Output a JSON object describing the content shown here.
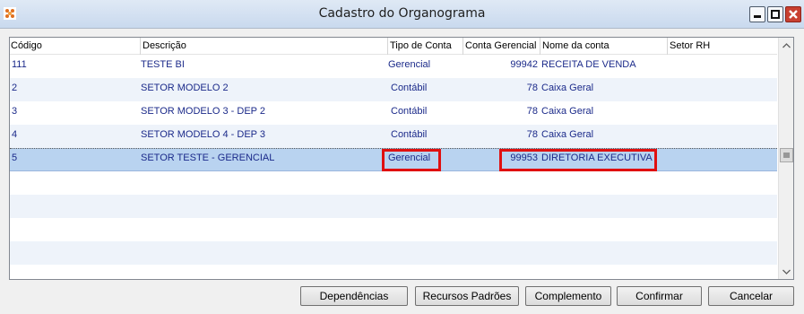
{
  "window": {
    "title": "Cadastro do Organograma",
    "controls": [
      "minimize",
      "maximize",
      "close"
    ]
  },
  "grid": {
    "columns": [
      "Código",
      "Descrição",
      "Tipo de Conta",
      "Conta Gerencial",
      "Nome da conta",
      "Setor RH"
    ],
    "rows": [
      {
        "codigo": "111",
        "descricao": "TESTE BI",
        "tipo": "Gerencial",
        "conta": "99942",
        "nome": "RECEITA DE VENDA",
        "setor": ""
      },
      {
        "codigo": "2",
        "descricao": "SETOR MODELO 2",
        "tipo": "Contábil",
        "conta": "78",
        "nome": "Caixa Geral",
        "setor": ""
      },
      {
        "codigo": "3",
        "descricao": "SETOR MODELO 3 - DEP 2",
        "tipo": "Contábil",
        "conta": "78",
        "nome": "Caixa Geral",
        "setor": ""
      },
      {
        "codigo": "4",
        "descricao": "SETOR MODELO 4 - DEP 3",
        "tipo": "Contábil",
        "conta": "78",
        "nome": "Caixa Geral",
        "setor": ""
      },
      {
        "codigo": "5",
        "descricao": "SETOR TESTE - GERENCIAL",
        "tipo": "Gerencial",
        "conta": "99953",
        "nome": "DIRETORIA EXECUTIVA",
        "setor": ""
      }
    ],
    "selected_row": 4
  },
  "buttons": {
    "dependencias": "Dependências",
    "recursos": "Recursos Padrões",
    "complemento": "Complemento",
    "confirmar": "Confirmar",
    "cancelar": "Cancelar"
  },
  "colors": {
    "cell_text": "#1b2a8a",
    "highlight_box": "#e01010",
    "selected_row": "#b9d3f0",
    "alt_row": "#eef3fa"
  }
}
